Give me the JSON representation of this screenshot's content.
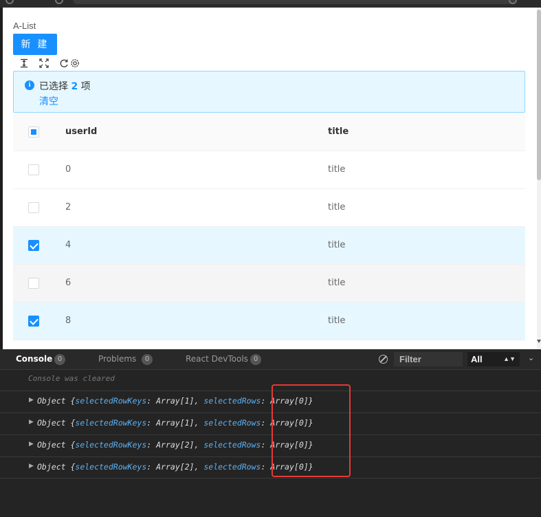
{
  "app": {
    "title": "A-List",
    "new_button": "新 建",
    "toolbar_icons": [
      "column-height-icon",
      "fullscreen-icon",
      "reload-icon",
      "setting-icon"
    ]
  },
  "selection_alert": {
    "prefix": "已选择",
    "count": "2",
    "suffix": "项",
    "clear": "清空"
  },
  "table": {
    "columns": [
      "userId",
      "title"
    ],
    "header_checkbox": "indeterminate",
    "rows": [
      {
        "userId": "0",
        "title": "title",
        "checked": false
      },
      {
        "userId": "2",
        "title": "title",
        "checked": false
      },
      {
        "userId": "4",
        "title": "title",
        "checked": true
      },
      {
        "userId": "6",
        "title": "title",
        "checked": false
      },
      {
        "userId": "8",
        "title": "title",
        "checked": true
      }
    ]
  },
  "devtools": {
    "tabs": [
      {
        "label": "Console",
        "count": "0",
        "active": true
      },
      {
        "label": "Problems",
        "count": "0",
        "active": false
      },
      {
        "label": "React DevTools",
        "count": "0",
        "active": false
      }
    ],
    "filter_placeholder": "Filter",
    "level": "All",
    "cleared_message": "Console was cleared",
    "logs": [
      {
        "prefix": "Object {",
        "k1": "selectedRowKeys",
        "v1": ": Array[1], ",
        "k2": "selectedRows",
        "v2": ": Array[0]}"
      },
      {
        "prefix": "Object {",
        "k1": "selectedRowKeys",
        "v1": ": Array[1], ",
        "k2": "selectedRows",
        "v2": ": Array[0]}"
      },
      {
        "prefix": "Object {",
        "k1": "selectedRowKeys",
        "v1": ": Array[2], ",
        "k2": "selectedRows",
        "v2": ": Array[0]}"
      },
      {
        "prefix": "Object {",
        "k1": "selectedRowKeys",
        "v1": ": Array[2], ",
        "k2": "selectedRows",
        "v2": ": Array[0]}"
      }
    ]
  },
  "colors": {
    "primary": "#1890ff",
    "alert_bg": "#e6f7ff",
    "highlight": "#e53935"
  }
}
